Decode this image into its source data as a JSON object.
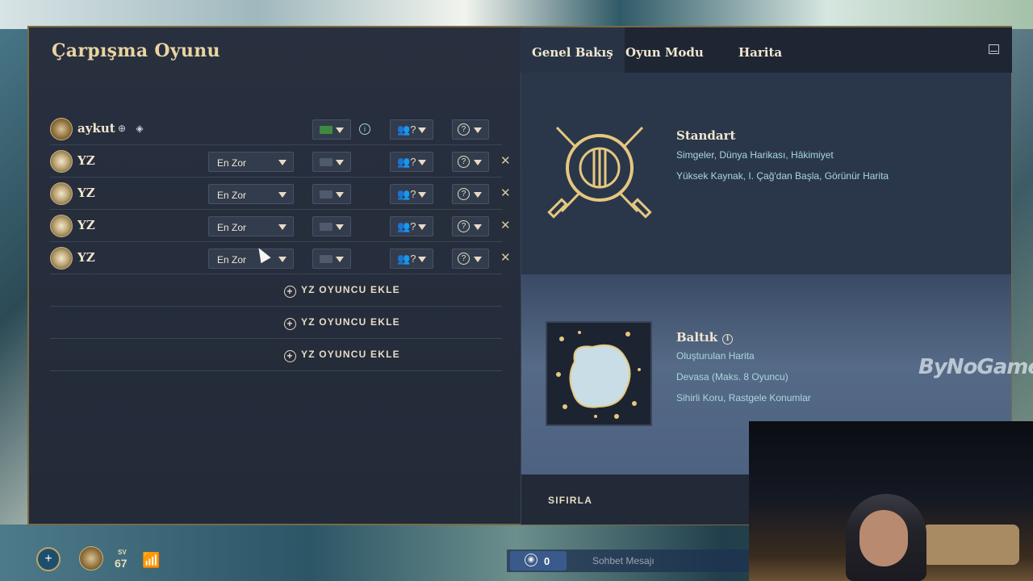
{
  "lobby": {
    "title": "Çarpışma Oyunu",
    "players": [
      {
        "name": "aykut",
        "is_ai": false,
        "difficulty": "",
        "team": "?",
        "civ": "?",
        "flag_color": "#3f8a3f"
      },
      {
        "name": "YZ",
        "is_ai": true,
        "difficulty": "En Zor",
        "team": "?",
        "civ": "?",
        "flag_color": "#4f5a6c"
      },
      {
        "name": "YZ",
        "is_ai": true,
        "difficulty": "En Zor",
        "team": "?",
        "civ": "?",
        "flag_color": "#4f5a6c"
      },
      {
        "name": "YZ",
        "is_ai": true,
        "difficulty": "En Zor",
        "team": "?",
        "civ": "?",
        "flag_color": "#4f5a6c"
      },
      {
        "name": "YZ",
        "is_ai": true,
        "difficulty": "En Zor",
        "team": "?",
        "civ": "?",
        "flag_color": "#4f5a6c"
      }
    ],
    "add_ai_label": "YZ OYUNCU EKLE",
    "add_ai_slots": 3
  },
  "tabs": [
    "Genel Bakış",
    "Oyun Modu",
    "Harita"
  ],
  "mode": {
    "title": "Standart",
    "line1": "Simgeler, Dünya Harikası, Hâkimiyet",
    "line2": "Yüksek Kaynak, I. Çağ'dan Başla, Görünür Harita"
  },
  "map": {
    "title": "Baltık",
    "line1": "Oluşturulan Harita",
    "line2": "Devasa (Maks. 8 Oyuncu)",
    "line3": "Sihirli Koru, Rastgele Konumlar"
  },
  "reset_label": "SIFIRLA",
  "hud": {
    "sv_label": "SV",
    "sv_value": "67",
    "chat_count": "0",
    "chat_placeholder": "Sohbet Mesajı"
  },
  "watermark": "ByNoGame",
  "colors": {
    "accent_gold": "#e9d4a1",
    "accent_blue": "#a9d7e0",
    "panel": "#283446"
  }
}
